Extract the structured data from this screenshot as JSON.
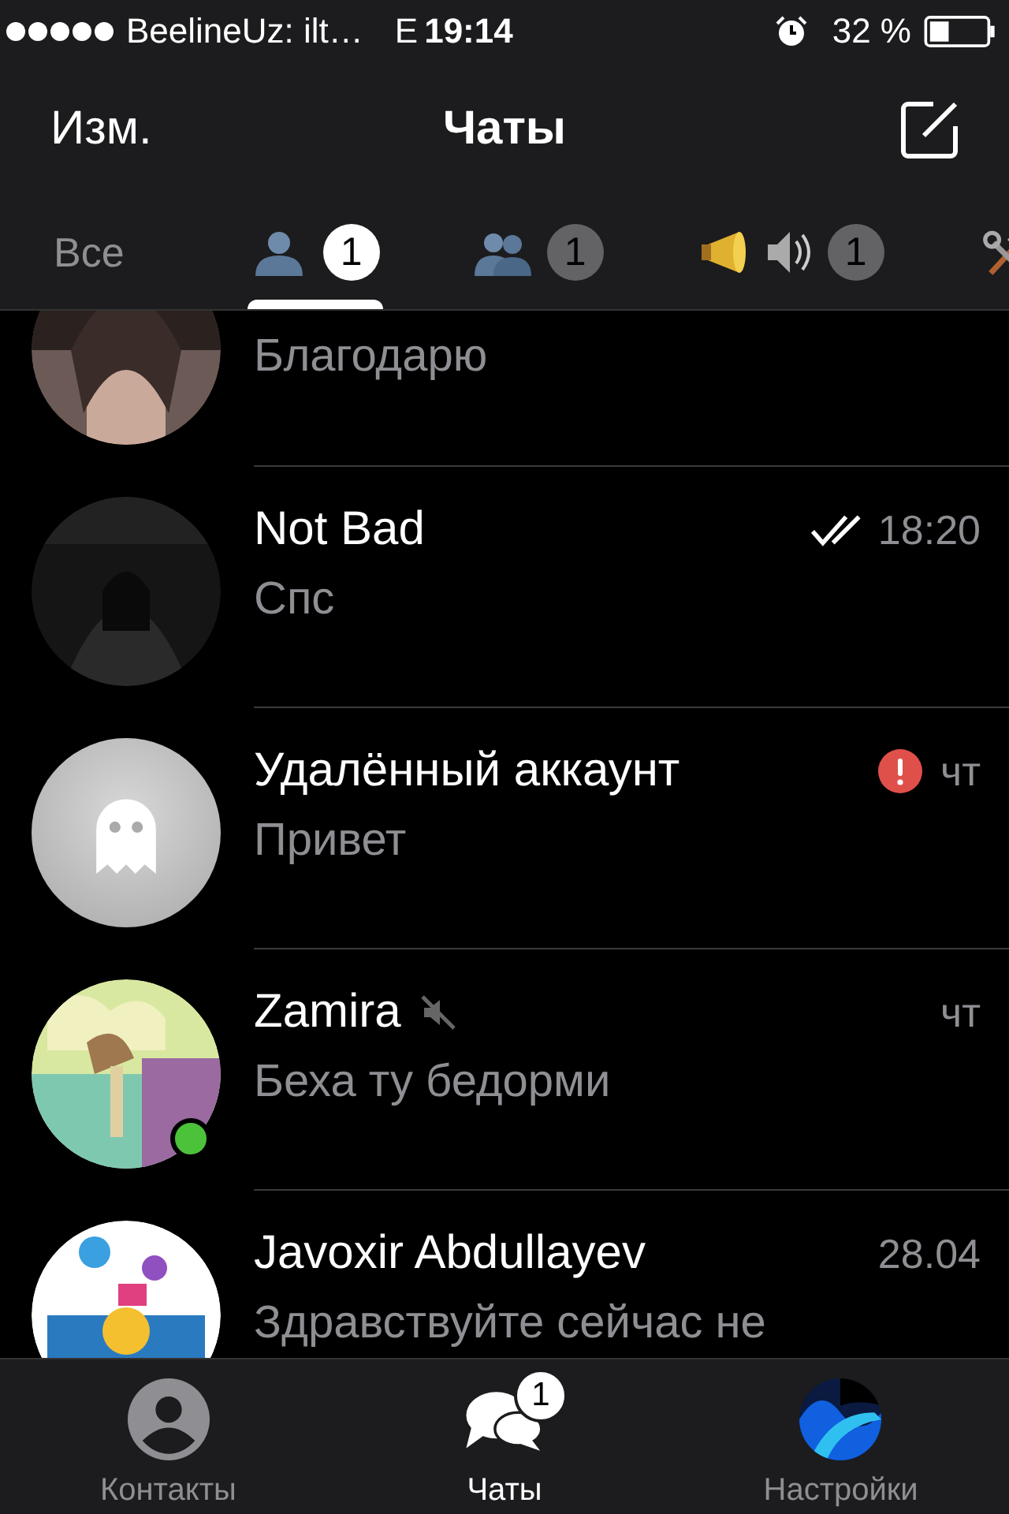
{
  "status_bar": {
    "carrier": "BeelineUz: ilt…",
    "network": "E",
    "time": "19:14",
    "battery": "32 %"
  },
  "nav": {
    "edit": "Изм.",
    "title": "Чаты"
  },
  "filter_tabs": [
    {
      "kind": "text",
      "label": "Все",
      "selected": false
    },
    {
      "kind": "person",
      "badge": "1",
      "selected": true
    },
    {
      "kind": "group",
      "badge": "1",
      "selected": false
    },
    {
      "kind": "broadcast",
      "badge": "1",
      "selected": false
    },
    {
      "kind": "tools",
      "selected": false
    }
  ],
  "chats": [
    {
      "kind": "picture",
      "message": "Благодарю"
    },
    {
      "kind": "picture",
      "name": "Not Bad",
      "message": "Спс",
      "time": "18:20",
      "read": true
    },
    {
      "kind": "ghost",
      "name": "Удалённый аккаунт",
      "message": "Привет",
      "time": "чт",
      "error": true
    },
    {
      "kind": "picture",
      "name": "Zamira",
      "message": "Беха ту бедорми",
      "time": "чт",
      "muted": true,
      "online": true
    },
    {
      "kind": "picture",
      "name": "Javoxir Abdullayev",
      "message": "Здравствуйте сейчас не",
      "time": "28.04"
    }
  ],
  "tab_bar": [
    {
      "kind": "contacts",
      "label": "Контакты",
      "selected": false
    },
    {
      "kind": "chats",
      "label": "Чаты",
      "badge": "1",
      "selected": true
    },
    {
      "kind": "settings",
      "label": "Настройки",
      "selected": false
    }
  ]
}
